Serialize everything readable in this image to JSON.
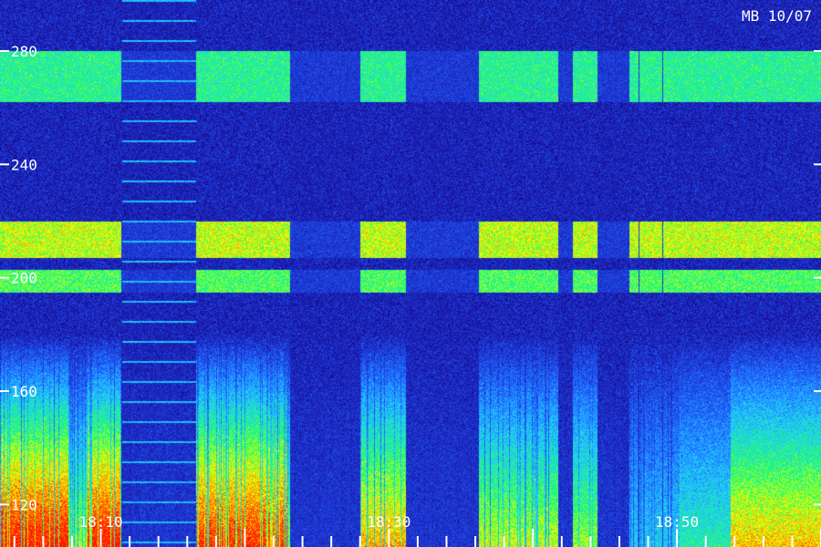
{
  "title": "MB 10/07",
  "chart_data": {
    "type": "heatmap",
    "title": "MB 10/07",
    "xlabel": "",
    "ylabel": "",
    "y_ticks": [
      "280",
      "240",
      "200",
      "160",
      "120"
    ],
    "y_tick_values": [
      280,
      240,
      200,
      160,
      120
    ],
    "ylim": [
      105,
      298
    ],
    "x_ticks": [
      "18:10",
      "18:30",
      "18:50"
    ],
    "x_range": [
      "18:03",
      "19:00"
    ],
    "minor_x_tick_step_minutes": 2,
    "grid": false,
    "colormap": [
      "#000010",
      "#1a10a0",
      "#2060ff",
      "#20d0ff",
      "#20ff60",
      "#ffff00",
      "#ff8000",
      "#ff1000"
    ],
    "description_bands_y": [
      {
        "y_from": 262,
        "y_to": 280,
        "level": 0.35
      },
      {
        "y_from": 207,
        "y_to": 220,
        "level": 0.5
      },
      {
        "y_from": 195,
        "y_to": 203,
        "level": 0.4
      }
    ]
  }
}
